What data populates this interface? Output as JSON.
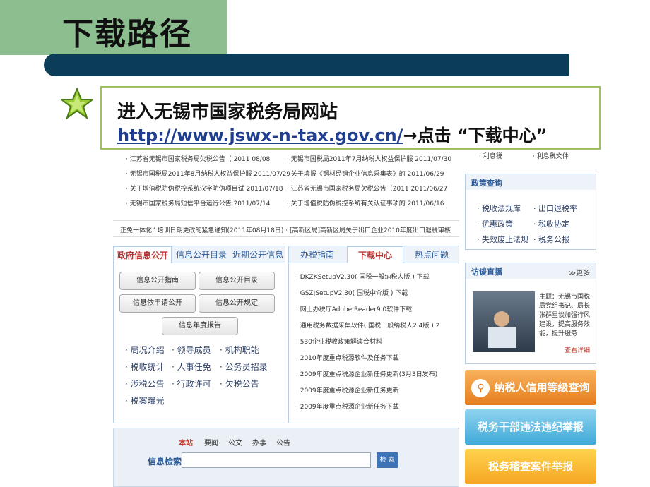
{
  "slide": {
    "title": "下载路径",
    "callout_line1": "进入无锡市国家税务局网站",
    "callout_url": "http://www.jswx-n-tax.gov.cn/",
    "callout_arrow_text": "→点击 “下载中心”"
  },
  "site": {
    "news_left": [
      "· 江苏省无锡市国家税务局欠税公告（ 2011 08/08",
      "· 无锡市国税局2011年8月纳税人权益保护服 2011/07/29",
      "· 关于增值税防伪税控系统汉字防伪项目试 2011/07/18",
      "· 无锡市国家税务局短信平台运行公告 2011/07/14"
    ],
    "news_right": [
      "· 无锡市国税局2011年7月纳税人权益保护服 2011/07/30",
      "· 关于填报《钢材经销企业信息采集表》的 2011/06/29",
      "· 江苏省无锡市国家税务局欠税公告（2011 2011/06/27",
      "· 关于增值税防伪税控系统有关认证事项的 2011/06/16"
    ],
    "ticker": "正免一体化” 培训日期更改的紧急通知(2011年08月18日) · [高新区局]高新区局关于出口企业2010年度出口退税审核",
    "gov_tabs": [
      "政府信息公开",
      "信息公开目录",
      "近期公开信息"
    ],
    "gov_buttons": [
      "信息公开指南",
      "信息公开目录",
      "信息依申请公开",
      "信息公开规定",
      "信息年度报告"
    ],
    "gov_links": [
      "· 局况介绍",
      "· 领导成员",
      "· 机构职能",
      "· 税收统计",
      "· 人事任免",
      "· 公务员招录",
      "· 涉税公告",
      "· 行政许可",
      "· 欠税公告",
      "· 税案曝光"
    ],
    "dl_tabs": [
      "办税指南",
      "下载中心",
      "热点问题"
    ],
    "downloads": [
      "· DKZKSetupV2.30( 国税一般纳税人版 ) 下载",
      "· GSZJSetupV2.30( 国税中介版 ) 下载",
      "· 网上办税厅Adobe Reader9.0软件下载",
      "· 通用税务数据采集软件( 国税一般纳税人2.4版 ) 2",
      "· 530企业税收政策解读合材料",
      "· 2010年度重点税源软件及任务下载",
      "· 2009年度重点税源企业新任务更新(3月3日发布)",
      "· 2009年度重点税源企业新任务更新",
      "· 2009年度重点税源企业新任务下载"
    ],
    "top_right_links": [
      "· 利息税",
      "· 利息税文件"
    ],
    "policy": {
      "header": "政策查询",
      "links": [
        "· 税收法规库",
        "· 出口退税率",
        "· 优惠政策",
        "· 税收协定",
        "· 失效废止法规",
        "· 税务公报"
      ]
    },
    "interview": {
      "header": "访谈直播",
      "more": "≫更多",
      "text": "主题：无锡市国税局党组书记、局长张群星谈加强行风建设，提高服务效能，提升服务",
      "detail": "查看详细"
    },
    "banners": [
      "纳税人信用等级查询",
      "税务干部违法违纪举报",
      "税务稽查案件举报"
    ],
    "search": {
      "tabs": [
        "本站",
        "要闻",
        "公文",
        "办事",
        "公告"
      ],
      "label": "信息检索",
      "button": "检 索"
    }
  },
  "colors": {
    "accent_green": "#8dbe8f",
    "title_bar": "#0b3d58",
    "callout_border": "#9fc062",
    "url": "#1f3e8f"
  }
}
